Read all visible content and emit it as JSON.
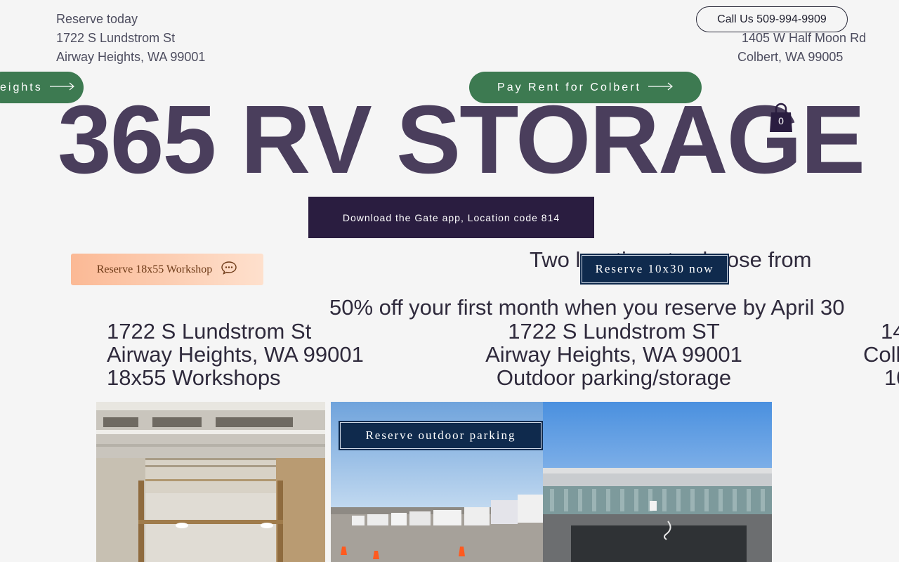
{
  "header": {
    "left_address": [
      "Reserve today",
      "1722 S Lundstrom St",
      "Airway Heights, WA 99001"
    ],
    "right_address": [
      "1405 W Half Moon Rd",
      "Colbert, WA 99005"
    ],
    "call_label": "Call Us 509-994-9909",
    "pay_airway_label": "eights",
    "pay_colbert_label": "Pay Rent for Colbert"
  },
  "hero": {
    "title": "365 RV STORAGE",
    "cart_count": "0",
    "gate_app_label": "Download the Gate app, Location code 814"
  },
  "actions": {
    "workshop_label": "Reserve 18x55 Workshop",
    "reserve_10x30_label": "Reserve 10x30 now",
    "reserve_outdoor_label": "Reserve outdoor parking"
  },
  "content": {
    "two_locations": "Two locations to choose from",
    "promo": "50% off your first month when you reserve by April 30",
    "locations": [
      {
        "lines": [
          "1722 S Lundstrom St",
          "Airway Heights, WA 99001",
          "18x55 Workshops"
        ]
      },
      {
        "lines": [
          "1722 S Lundstrom ST",
          "Airway Heights, WA 99001",
          "Outdoor parking/storage"
        ]
      },
      {
        "lines": [
          "14",
          "Coll",
          "10"
        ]
      }
    ]
  },
  "colors": {
    "green": "#3d7a51",
    "navy": "#0f2a4d",
    "dark_purple": "#2a1d40",
    "title": "#4a3e5c",
    "peach": "#fbb995"
  }
}
